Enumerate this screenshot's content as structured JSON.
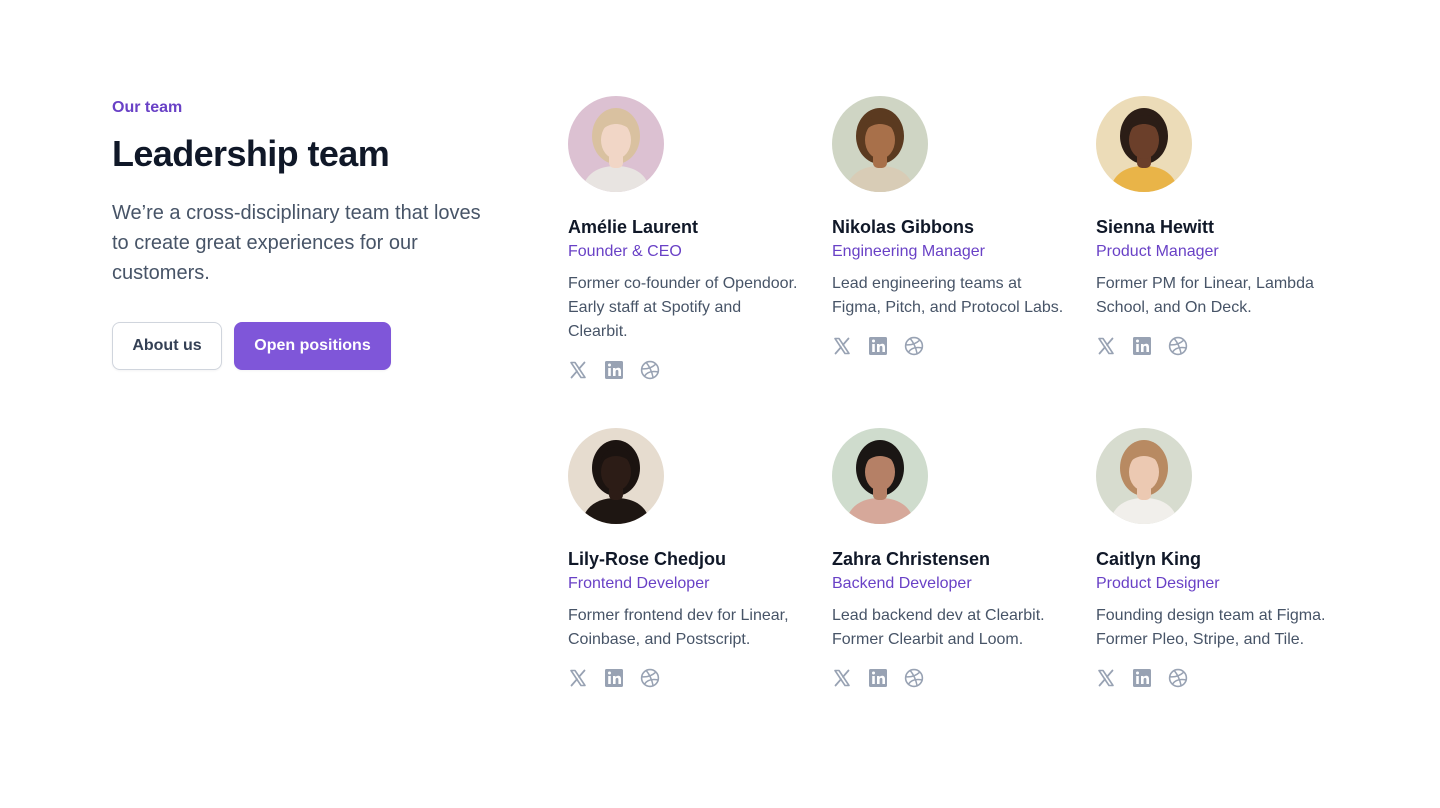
{
  "section": {
    "eyebrow": "Our team",
    "title": "Leadership team",
    "description": "We’re a cross-disciplinary team that loves to create great experiences for our customers.",
    "buttons": {
      "secondary": "About us",
      "primary": "Open positions"
    }
  },
  "colors": {
    "accent": "#7f56d9",
    "accent_text": "#6941c6",
    "icon_gray": "#98a2b3"
  },
  "team": [
    {
      "name": "Amélie Laurent",
      "role": "Founder & CEO",
      "bio": "Former co-founder of Opendoor. Early staff at Spotify and Clearbit.",
      "avatar_bg": "#dcc1d2",
      "hair": "#d9c1a0",
      "skin": "#f1d6c6",
      "shirt": "#e8e4e1",
      "socials": [
        "x-icon",
        "linkedin-icon",
        "dribbble-icon"
      ]
    },
    {
      "name": "Nikolas Gibbons",
      "role": "Engineering Manager",
      "bio": "Lead engineering teams at Figma, Pitch, and Protocol Labs.",
      "avatar_bg": "#cfd5c4",
      "hair": "#5b3a20",
      "skin": "#a8704a",
      "shirt": "#d8ccb6",
      "socials": [
        "x-icon",
        "linkedin-icon",
        "dribbble-icon"
      ]
    },
    {
      "name": "Sienna Hewitt",
      "role": "Product Manager",
      "bio": "Former PM for Linear, Lambda School, and On Deck.",
      "avatar_bg": "#ecdcb8",
      "hair": "#2b1d16",
      "skin": "#6b3f2a",
      "shirt": "#e9b448",
      "socials": [
        "x-icon",
        "linkedin-icon",
        "dribbble-icon"
      ]
    },
    {
      "name": "Lily-Rose Chedjou",
      "role": "Frontend Developer",
      "bio": "Former frontend dev for Linear, Coinbase, and Postscript.",
      "avatar_bg": "#e6dccf",
      "hair": "#1b1310",
      "skin": "#2c1c16",
      "shirt": "#1e1612",
      "socials": [
        "x-icon",
        "linkedin-icon",
        "dribbble-icon"
      ]
    },
    {
      "name": "Zahra Christensen",
      "role": "Backend Developer",
      "bio": "Lead backend dev at Clearbit. Former Clearbit and Loom.",
      "avatar_bg": "#cfdccd",
      "hair": "#1a1614",
      "skin": "#b58066",
      "shirt": "#d6a89a",
      "socials": [
        "x-icon",
        "linkedin-icon",
        "dribbble-icon"
      ]
    },
    {
      "name": "Caitlyn King",
      "role": "Product Designer",
      "bio": "Founding design team at Figma. Former Pleo, Stripe, and Tile.",
      "avatar_bg": "#d7dccf",
      "hair": "#b88a62",
      "skin": "#ecc9b2",
      "shirt": "#f1efeb",
      "socials": [
        "x-icon",
        "linkedin-icon",
        "dribbble-icon"
      ]
    }
  ]
}
